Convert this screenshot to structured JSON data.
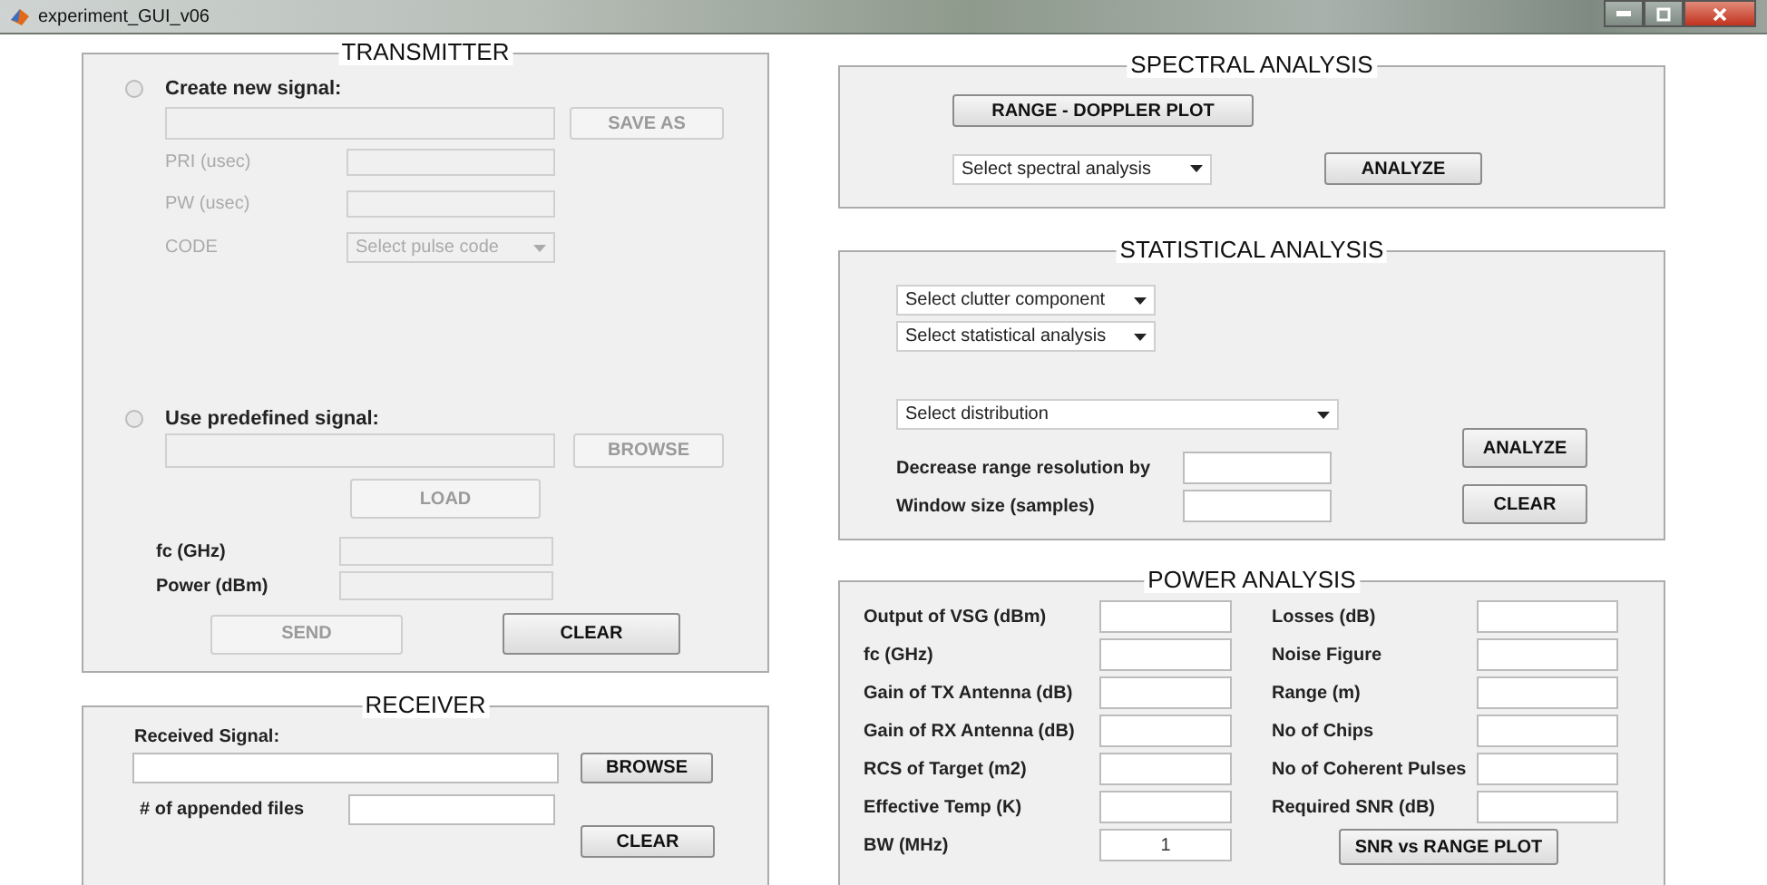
{
  "window": {
    "title": "experiment_GUI_v06"
  },
  "transmitter": {
    "title": "TRANSMITTER",
    "new_signal": {
      "label": "Create new signal:",
      "selected": false
    },
    "new_signal_field": {
      "disabled": true
    },
    "save_as_button": {
      "label": "SAVE AS",
      "disabled": true
    },
    "params": [
      {
        "kind": "field",
        "label": "PRI (usec)",
        "disabled": true
      },
      {
        "kind": "field",
        "label": "PW (usec)",
        "disabled": true
      },
      {
        "kind": "dropdown",
        "label": "CODE",
        "placeholder": "Select pulse code",
        "disabled": true
      }
    ],
    "predefined_signal": {
      "label": "Use predefined signal:",
      "selected": false
    },
    "predefined_field": {
      "disabled": true
    },
    "browse_button": {
      "label": "BROWSE",
      "disabled": true
    },
    "load_button": {
      "label": "LOAD",
      "disabled": true
    },
    "fields": [
      {
        "label": "fc (GHz)",
        "disabled": true
      },
      {
        "label": "Power (dBm)",
        "disabled": true
      }
    ],
    "send_button": {
      "label": "SEND",
      "disabled": true
    },
    "clear_button": {
      "label": "CLEAR",
      "disabled": false
    }
  },
  "receiver": {
    "title": "RECEIVER",
    "signal_label": "Received Signal:",
    "browse_button": {
      "label": "BROWSE",
      "disabled": false
    },
    "appended_label": "# of appended files",
    "clear_button": {
      "label": "CLEAR",
      "disabled": false
    }
  },
  "spectral_analysis": {
    "title": "SPECTRAL ANALYSIS",
    "plot_button": {
      "label": "RANGE - DOPPLER PLOT",
      "disabled": false
    },
    "dropdown": {
      "placeholder": "Select spectral analysis"
    },
    "analyze_button": {
      "label": "ANALYZE",
      "disabled": false
    }
  },
  "statistical_analysis": {
    "title": "STATISTICAL ANALYSIS",
    "dropdowns": [
      {
        "placeholder": "Select clutter component"
      },
      {
        "placeholder": "Select statistical analysis"
      }
    ],
    "distribution_dropdown": {
      "placeholder": "Select distribution"
    },
    "fields": [
      {
        "label": "Decrease range resolution by"
      },
      {
        "label": "Window size (samples)"
      }
    ],
    "analyze_button": {
      "label": "ANALYZE",
      "disabled": false
    },
    "clear_button": {
      "label": "CLEAR",
      "disabled": false
    }
  },
  "power_analysis": {
    "title": "POWER ANALYSIS",
    "left_fields": [
      {
        "label": "Output of VSG (dBm)"
      },
      {
        "label": "fc (GHz)"
      },
      {
        "label": "Gain of TX Antenna (dB)"
      },
      {
        "label": "Gain of RX Antenna (dB)"
      },
      {
        "label": "RCS of Target (m2)"
      },
      {
        "label": "Effective Temp (K)"
      },
      {
        "label": "BW (MHz)",
        "value": "1"
      }
    ],
    "right_fields": [
      {
        "label": "Losses (dB)"
      },
      {
        "label": "Noise Figure"
      },
      {
        "label": "Range (m)"
      },
      {
        "label": "No of Chips"
      },
      {
        "label": "No of Coherent Pulses"
      },
      {
        "label": "Required SNR (dB)"
      }
    ],
    "plot_button": {
      "label": "SNR vs RANGE PLOT",
      "disabled": false
    }
  }
}
